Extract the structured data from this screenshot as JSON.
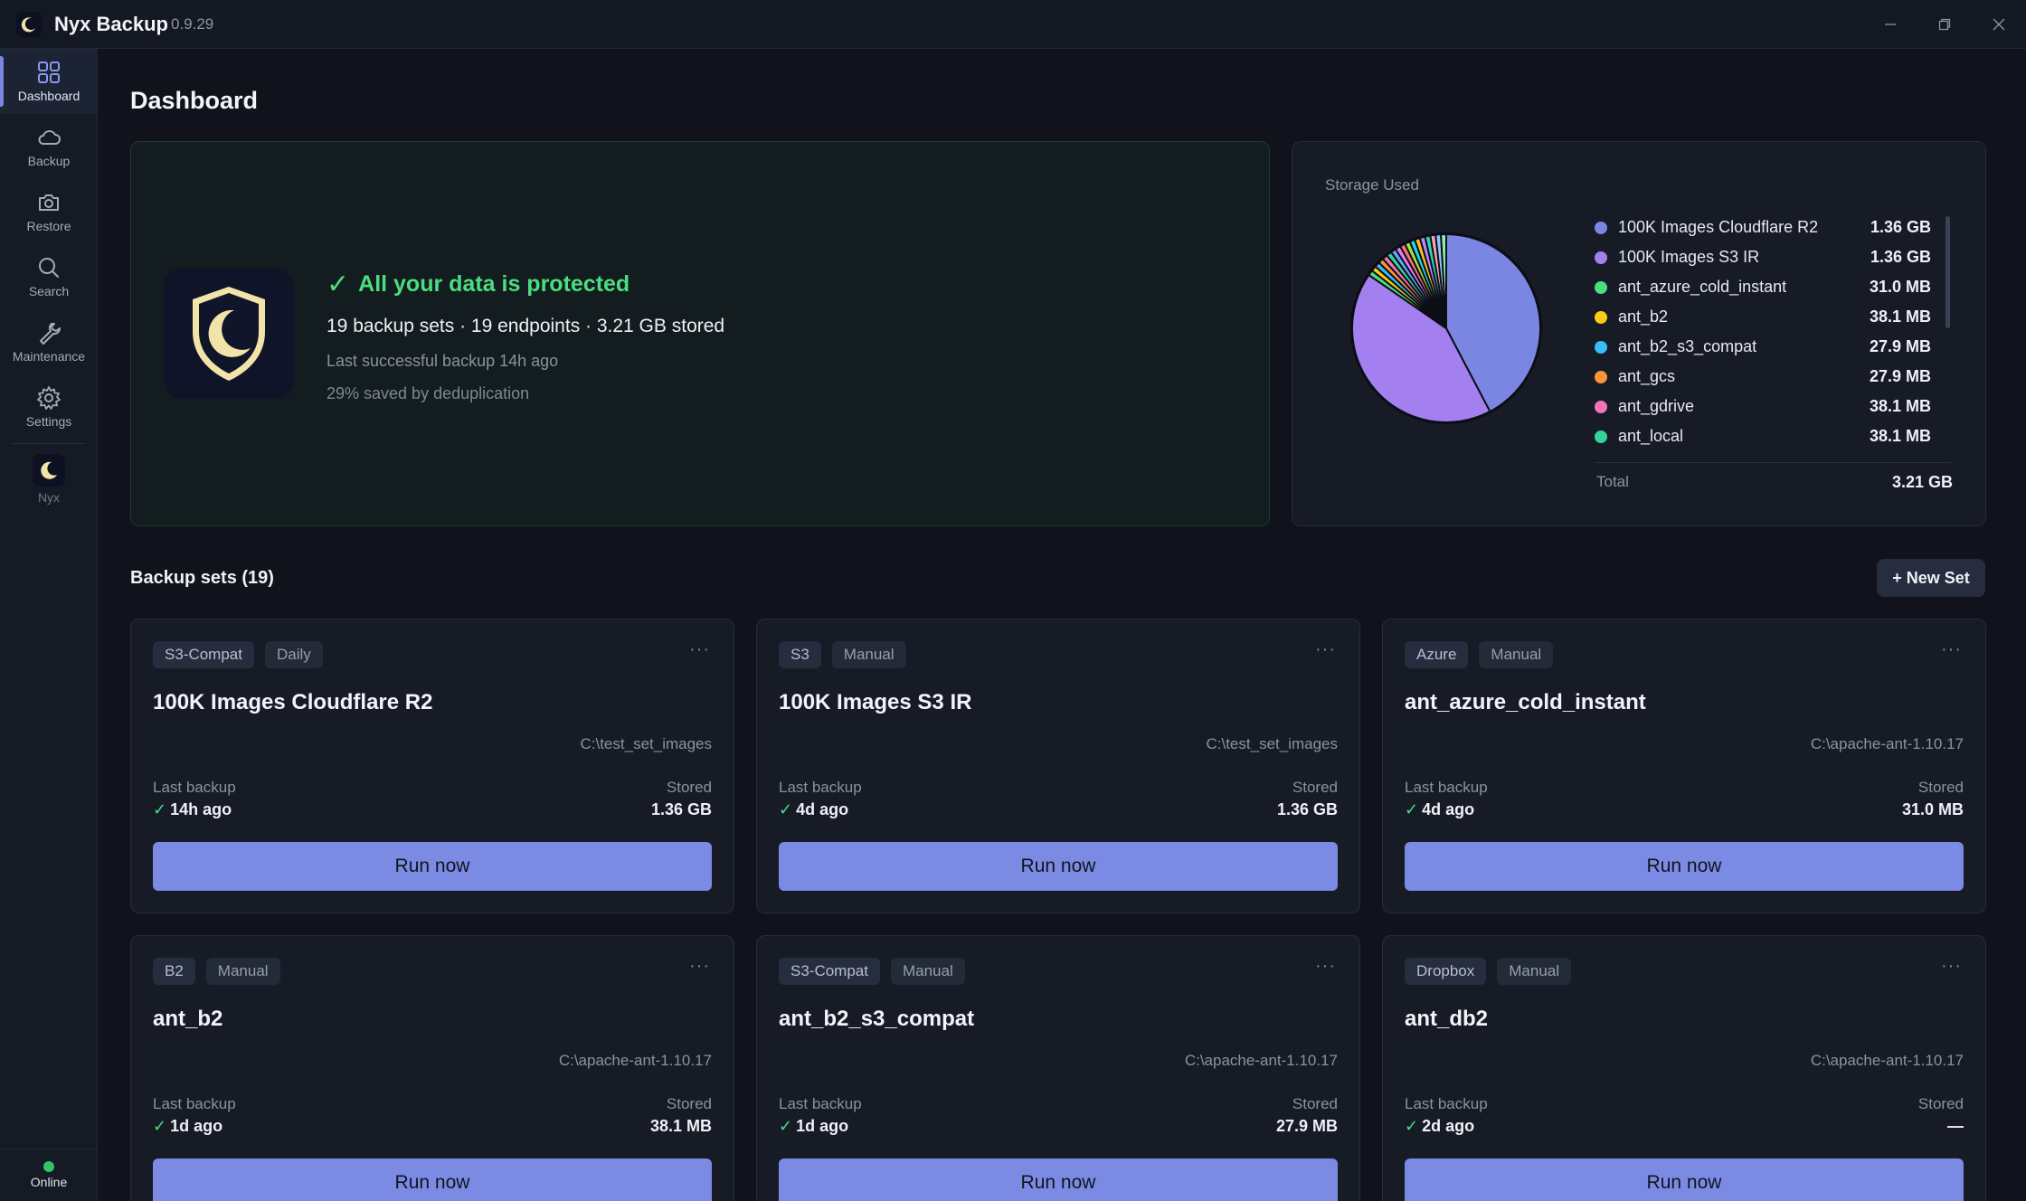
{
  "app": {
    "title": "Nyx Backup",
    "version": "0.9.29"
  },
  "sidebar": {
    "items": [
      {
        "label": "Dashboard",
        "icon": "grid-icon"
      },
      {
        "label": "Backup",
        "icon": "cloud-icon"
      },
      {
        "label": "Restore",
        "icon": "camera-icon"
      },
      {
        "label": "Search",
        "icon": "search-icon"
      },
      {
        "label": "Maintenance",
        "icon": "wrench-icon"
      },
      {
        "label": "Settings",
        "icon": "gear-icon"
      }
    ],
    "brand_label": "Nyx",
    "status": "Online"
  },
  "page": {
    "title": "Dashboard"
  },
  "hero": {
    "status": "All your data is protected",
    "stats": "19 backup sets · 19 endpoints · 3.21 GB stored",
    "last_backup": "Last successful backup 14h ago",
    "dedup": "29% saved by deduplication"
  },
  "storage": {
    "title": "Storage Used",
    "legend": [
      {
        "name": "100K Images Cloudflare R2",
        "value": "1.36 GB",
        "color": "#7b86e3"
      },
      {
        "name": "100K Images S3 IR",
        "value": "1.36 GB",
        "color": "#a47ff0"
      },
      {
        "name": "ant_azure_cold_instant",
        "value": "31.0 MB",
        "color": "#4ade80"
      },
      {
        "name": "ant_b2",
        "value": "38.1 MB",
        "color": "#facc15"
      },
      {
        "name": "ant_b2_s3_compat",
        "value": "27.9 MB",
        "color": "#38bdf8"
      },
      {
        "name": "ant_gcs",
        "value": "27.9 MB",
        "color": "#fb923c"
      },
      {
        "name": "ant_gdrive",
        "value": "38.1 MB",
        "color": "#f472b6"
      },
      {
        "name": "ant_local",
        "value": "38.1 MB",
        "color": "#34d399"
      }
    ],
    "total_label": "Total",
    "total_value": "3.21 GB"
  },
  "sets": {
    "title": "Backup sets (19)",
    "new_label": "+ New Set",
    "last_label": "Last backup",
    "stored_label": "Stored",
    "run_label": "Run now",
    "cards": [
      {
        "provider": "S3-Compat",
        "schedule": "Daily",
        "name": "100K Images Cloudflare R2",
        "path": "C:\\test_set_images",
        "last": "14h ago",
        "stored": "1.36 GB",
        "ok": "✓"
      },
      {
        "provider": "S3",
        "schedule": "Manual",
        "name": "100K Images S3 IR",
        "path": "C:\\test_set_images",
        "last": "4d ago",
        "stored": "1.36 GB",
        "ok": "✓"
      },
      {
        "provider": "Azure",
        "schedule": "Manual",
        "name": "ant_azure_cold_instant",
        "path": "C:\\apache-ant-1.10.17",
        "last": "4d ago",
        "stored": "31.0 MB",
        "ok": "✓"
      },
      {
        "provider": "B2",
        "schedule": "Manual",
        "name": "ant_b2",
        "path": "C:\\apache-ant-1.10.17",
        "last": "1d ago",
        "stored": "38.1 MB",
        "ok": "✓"
      },
      {
        "provider": "S3-Compat",
        "schedule": "Manual",
        "name": "ant_b2_s3_compat",
        "path": "C:\\apache-ant-1.10.17",
        "last": "1d ago",
        "stored": "27.9 MB",
        "ok": "✓"
      },
      {
        "provider": "Dropbox",
        "schedule": "Manual",
        "name": "ant_db2",
        "path": "C:\\apache-ant-1.10.17",
        "last": "2d ago",
        "stored": "—",
        "ok": "✓"
      }
    ]
  }
}
